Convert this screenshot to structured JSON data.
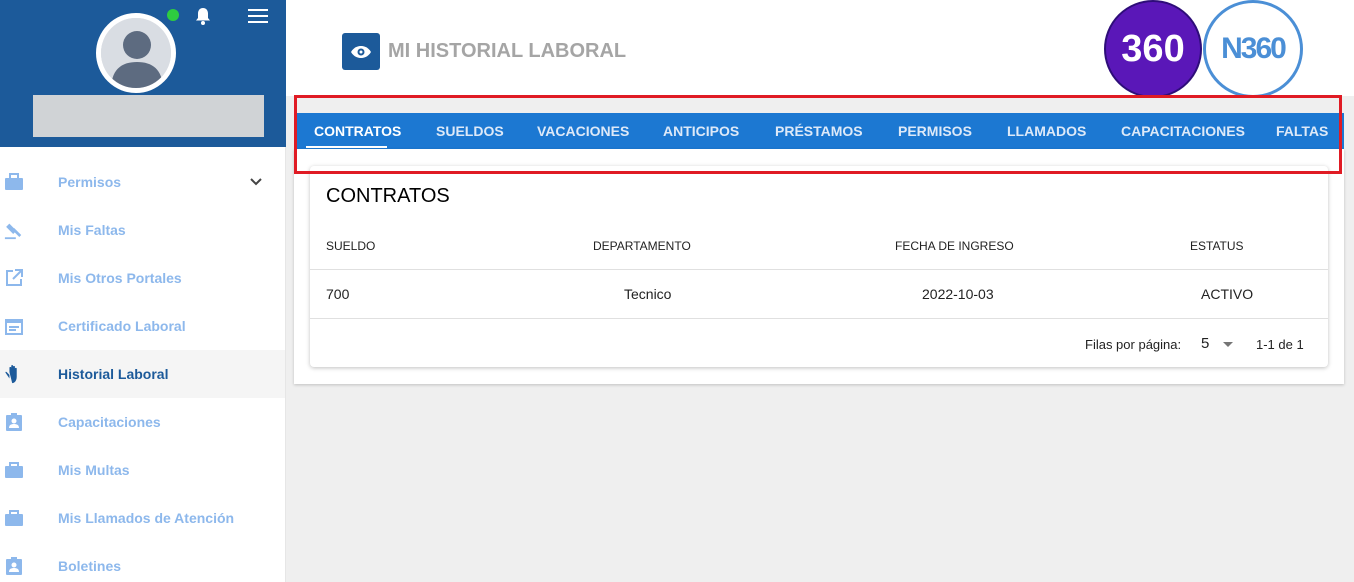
{
  "sidebar": {
    "items": [
      {
        "label": "Permisos",
        "icon": "briefcase-icon",
        "has_chevron": true
      },
      {
        "label": "Mis Faltas",
        "icon": "gavel-icon"
      },
      {
        "label": "Mis Otros Portales",
        "icon": "external-link-icon"
      },
      {
        "label": "Certificado Laboral",
        "icon": "calendar-icon"
      },
      {
        "label": "Historial Laboral",
        "icon": "hand-icon",
        "active": true
      },
      {
        "label": "Capacitaciones",
        "icon": "badge-icon"
      },
      {
        "label": "Mis Multas",
        "icon": "briefcase-icon"
      },
      {
        "label": "Mis Llamados de Atención",
        "icon": "briefcase-icon"
      },
      {
        "label": "Boletines",
        "icon": "badge-icon"
      }
    ]
  },
  "header": {
    "title": "MI HISTORIAL LABORAL",
    "logo_360": "360",
    "logo_n360": "N360"
  },
  "tabs": [
    "CONTRATOS",
    "SUELDOS",
    "VACACIONES",
    "ANTICIPOS",
    "PRÉSTAMOS",
    "PERMISOS",
    "LLAMADOS",
    "CAPACITACIONES",
    "FALTAS"
  ],
  "contracts": {
    "title": "CONTRATOS",
    "columns": [
      "SUELDO",
      "DEPARTAMENTO",
      "FECHA DE INGRESO",
      "ESTATUS"
    ],
    "rows": [
      [
        "700",
        "Tecnico",
        "2022-10-03",
        "ACTIVO"
      ]
    ],
    "pagination": {
      "rows_label": "Filas por página:",
      "rows_value": "5",
      "range": "1-1 de 1"
    }
  },
  "colors": {
    "primary": "#1c5a9a",
    "tab_bar": "#1c78d2",
    "highlight": "#e01b24",
    "menu_text": "#8db8ec",
    "online": "#2ecc40"
  }
}
